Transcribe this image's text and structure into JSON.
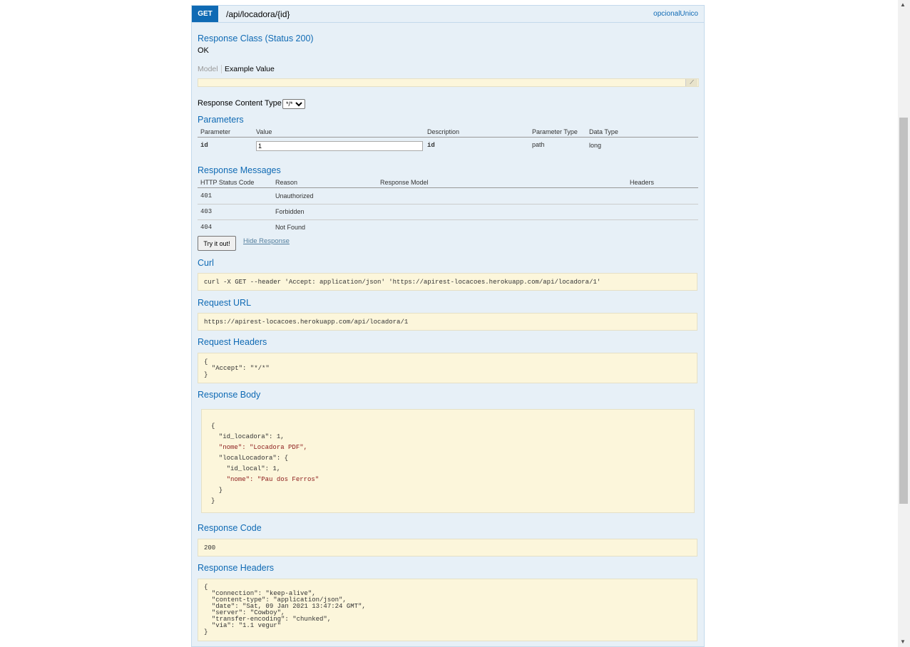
{
  "operation": {
    "method": "GET",
    "path": "/api/locadora/{id}",
    "nickname": "opcionalUnico"
  },
  "response_class": {
    "title": "Response Class (Status 200)",
    "value": "OK",
    "model_tab": "Model",
    "example_tab": "Example Value"
  },
  "content_type": {
    "label": "Response Content Type",
    "selected": "*/*"
  },
  "parameters": {
    "title": "Parameters",
    "headers": [
      "Parameter",
      "Value",
      "Description",
      "Parameter Type",
      "Data Type"
    ],
    "rows": [
      {
        "name": "id",
        "value": "1",
        "description": "id",
        "param_type": "path",
        "data_type": "long"
      }
    ]
  },
  "response_messages": {
    "title": "Response Messages",
    "headers": [
      "HTTP Status Code",
      "Reason",
      "Response Model",
      "Headers"
    ],
    "rows": [
      {
        "code": "401",
        "reason": "Unauthorized"
      },
      {
        "code": "403",
        "reason": "Forbidden"
      },
      {
        "code": "404",
        "reason": "Not Found"
      }
    ]
  },
  "actions": {
    "try_button": "Try it out!",
    "hide_link": "Hide Response"
  },
  "curl": {
    "title": "Curl",
    "command": "curl -X GET --header 'Accept: application/json' 'https://apirest-locacoes.herokuapp.com/api/locadora/1'"
  },
  "request_url": {
    "title": "Request URL",
    "value": "https://apirest-locacoes.herokuapp.com/api/locadora/1"
  },
  "request_headers": {
    "title": "Request Headers",
    "lines": [
      "{",
      "  \"Accept\": \"*/*\"",
      "}"
    ]
  },
  "response_body": {
    "title": "Response Body",
    "lines": [
      "{",
      "  \"id_locadora\": 1,",
      "  \"nome\": \"Locadora PDF\",",
      "  \"localLocadora\": {",
      "    \"id_local\": 1,",
      "    \"nome\": \"Pau dos Ferros\"",
      "  }",
      "}"
    ]
  },
  "response_code": {
    "title": "Response Code",
    "value": "200"
  },
  "response_headers": {
    "title": "Response Headers",
    "lines": [
      "{",
      "  \"connection\": \"keep-alive\",",
      "  \"content-type\": \"application/json\",",
      "  \"date\": \"Sat, 09 Jan 2021 13:47:24 GMT\",",
      "  \"server\": \"Cowboy\",",
      "  \"transfer-encoding\": \"chunked\",",
      "  \"via\": \"1.1 vegur\"",
      "}"
    ]
  }
}
